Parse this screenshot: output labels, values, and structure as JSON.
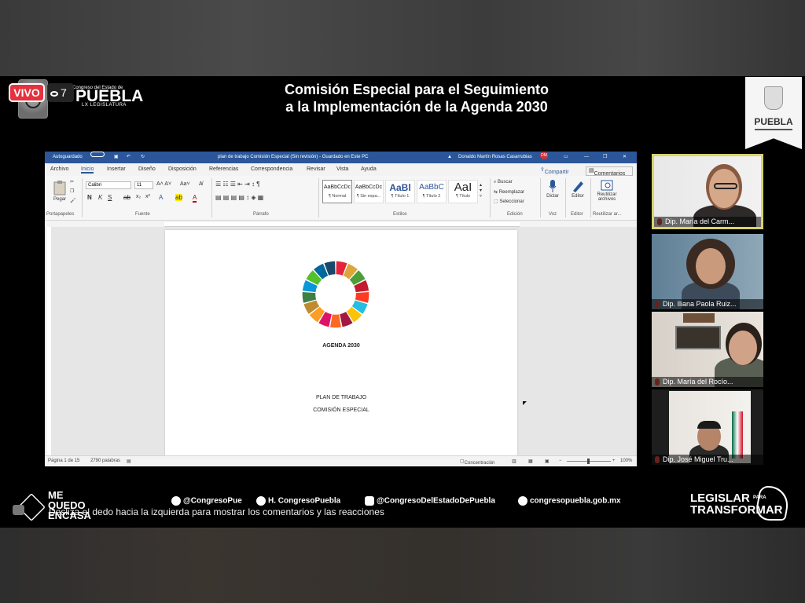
{
  "live": {
    "label": "VIVO",
    "viewers": "7"
  },
  "brand": {
    "org_small": "Congreso del Estado de",
    "name": "PUEBLA",
    "legislature": "LX LEGISLATURA"
  },
  "header": {
    "title_line1": "Comisión Especial para el Seguimiento",
    "title_line2": "a la Implementación de la Agenda 2030",
    "badge": "PUEBLA"
  },
  "word": {
    "autosave": "Autoguardado",
    "doc_title": "plan de trabajo Comisión Especial (Sin revisión) - Guardado en Este PC",
    "user": "Donaldo Martín Rosas Casarrubias",
    "user_initials": "DM",
    "menu": [
      "Archivo",
      "Inicio",
      "Insertar",
      "Diseño",
      "Disposición",
      "Referencias",
      "Correspondencia",
      "Revisar",
      "Vista",
      "Ayuda"
    ],
    "share": "Compartir",
    "comments": "Comentarios",
    "font": "Calibri",
    "size": "11",
    "paste": "Pegar",
    "groups": [
      "Portapapeles",
      "Fuente",
      "Párrafo",
      "Estilos",
      "Edición",
      "Voz",
      "Editor",
      "Reutilizar ar..."
    ],
    "styles": [
      {
        "sample": "AaBbCcDc",
        "label": "¶ Normal"
      },
      {
        "sample": "AaBbCcDc",
        "label": "¶ Sin espa..."
      },
      {
        "sample": "AaBl",
        "label": "¶ Título 1"
      },
      {
        "sample": "AaBbC",
        "label": "¶ Título 2"
      },
      {
        "sample": "AaI",
        "label": "¶ Título"
      }
    ],
    "edit": {
      "find": "Buscar",
      "replace": "Reemplazar",
      "select": "Seleccionar"
    },
    "voice": "Dictar",
    "editor": "Editor",
    "reuse": "Reutilizar archivos",
    "page": {
      "agenda": "AGENDA 2030",
      "plan": "PLAN DE TRABAJO",
      "commission": "COMISIÓN ESPECIAL"
    },
    "status": {
      "page": "Página 1 de 15",
      "words": "2790 palabras",
      "focus": "Concentración",
      "zoom": "100%"
    }
  },
  "participants": [
    {
      "name": "Dip. María del Carm..."
    },
    {
      "name": "Dip. Iliana Paola Ruiz..."
    },
    {
      "name": "Dip. María del Rocío..."
    },
    {
      "name": "Dip. José Miguel Tru..."
    }
  ],
  "footer": {
    "mqc_line1": "ME",
    "mqc_line2": "QUEDO",
    "mqc_line3": "ENCASA",
    "twitter": "@CongresoPue",
    "facebook": "H. CongresoPuebla",
    "instagram": "@CongresoDelEstadoDePuebla",
    "web": "congresopuebla.gob.mx",
    "slogan_line1": "LEGISLAR",
    "slogan_para": "PARA",
    "slogan_line2": "TRANSFORMAR",
    "overlay": "Desliza el dedo hacia la izquierda para mostrar los comentarios y las reacciones"
  },
  "colors": {
    "live": "#e4323f",
    "word_blue": "#2b579a",
    "active_speaker": "#d7d46a"
  }
}
